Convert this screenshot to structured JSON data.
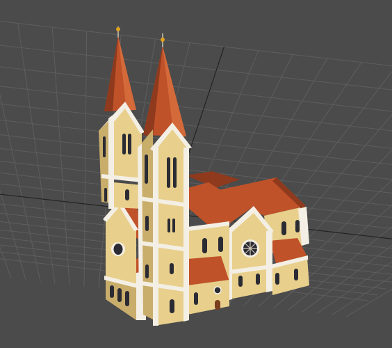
{
  "viewport": {
    "background_color": "#4b4b4b",
    "grid_color": "#5e5e5e",
    "grid_axis_color": "#222222"
  },
  "model": {
    "subject": "church",
    "palette": {
      "wall": "#e8cf8c",
      "wall_light": "#f1dea6",
      "wall_shadow": "#c9ad6b",
      "trim": "#f4efe4",
      "trim_shadow": "#cfc7b6",
      "roof": "#c0522a",
      "roof_dark": "#8f3a1d",
      "roof_light": "#d46a3a",
      "window": "#2b2b33",
      "finial": "#e0a21c"
    }
  }
}
